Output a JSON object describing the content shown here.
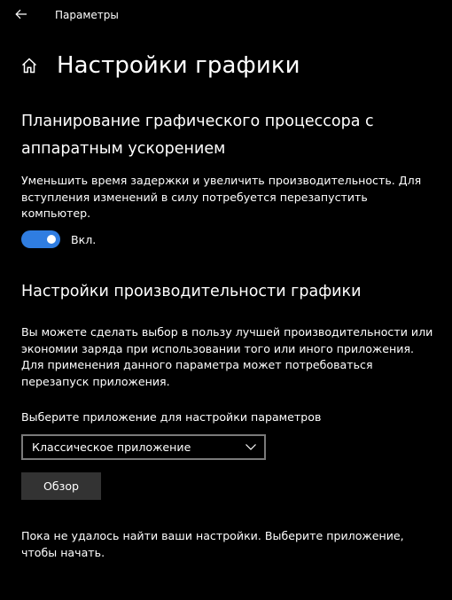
{
  "app": {
    "title": "Параметры"
  },
  "header": {
    "title": "Настройки графики"
  },
  "gpu_scheduling": {
    "title": "Планирование графического процессора с аппаратным ускорением",
    "description": "Уменьшить время задержки и увеличить производительность. Для вступления изменений в силу потребуется перезапустить компьютер.",
    "toggle_state": "Вкл.",
    "toggle_on": true
  },
  "performance": {
    "title": "Настройки производительности графики",
    "description": "Вы можете сделать выбор в пользу лучшей производительности или экономии заряда при использовании того или иного приложения. Для применения данного параметра может потребоваться перезапуск приложения.",
    "select_label": "Выберите приложение для настройки параметров",
    "select_value": "Классическое приложение",
    "browse_label": "Обзор",
    "empty_message": "Пока не удалось найти ваши настройки. Выберите приложение, чтобы начать."
  },
  "colors": {
    "background": "#000000",
    "accent": "#2f7de1",
    "button": "#333333",
    "border": "#7a7a7a"
  },
  "icons": {
    "back": "back-arrow-icon",
    "home": "home-icon",
    "chevron": "chevron-down-icon"
  }
}
